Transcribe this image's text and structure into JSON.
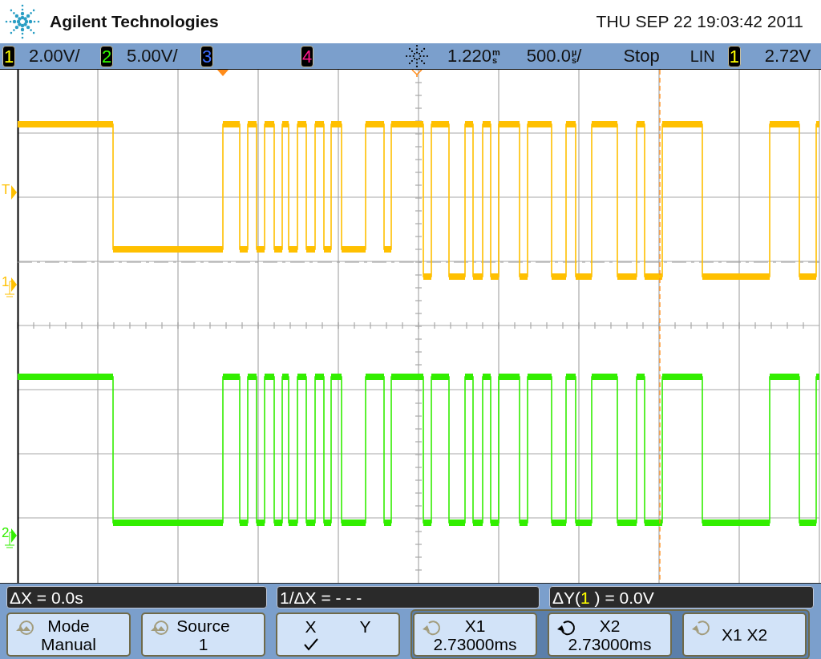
{
  "header": {
    "brand": "Agilent Technologies",
    "datetime": "THU SEP 22 19:03:42 2011"
  },
  "status_bar": {
    "channels": [
      {
        "number": "1",
        "scale": "2.00V/"
      },
      {
        "number": "2",
        "scale": "5.00V/"
      },
      {
        "number": "3"
      },
      {
        "number": "4"
      }
    ],
    "delay": {
      "value": "1.220",
      "unit_top": "m",
      "unit_bottom": "s"
    },
    "timebase": {
      "value": "500.0",
      "unit_top": "µ",
      "unit_bottom": "s",
      "suffix": "/"
    },
    "run_state": "Stop",
    "trigger": {
      "mode": "LIN",
      "source": "1",
      "level": "2.72V"
    }
  },
  "plot": {
    "markers": [
      {
        "label": "T",
        "color": "#ffc000"
      },
      {
        "label": "1",
        "color": "#ffc000"
      },
      {
        "label": "2",
        "color": "#33ee00"
      }
    ]
  },
  "readouts": [
    {
      "text": "ΔX = 0.0s"
    },
    {
      "text": "1/ΔX = - - -"
    },
    {
      "prefix": "ΔY(",
      "source": "1",
      "suffix": " ) = 0.0V"
    }
  ],
  "softkeys": [
    {
      "kind": "push",
      "title": "Mode",
      "value": "Manual",
      "active": false
    },
    {
      "kind": "push",
      "title": "Source",
      "value": "1",
      "active": false
    },
    {
      "kind": "toggle",
      "options": [
        {
          "label": "X",
          "selected": true
        },
        {
          "label": "Y",
          "selected": false
        }
      ]
    },
    {
      "kind": "rotate",
      "title": "X1",
      "value": "2.73000ms",
      "active": false
    },
    {
      "kind": "rotate",
      "title": "X2",
      "value": "2.73000ms",
      "active": true
    },
    {
      "kind": "rotate",
      "title": "X1 X2",
      "active": false
    }
  ]
}
